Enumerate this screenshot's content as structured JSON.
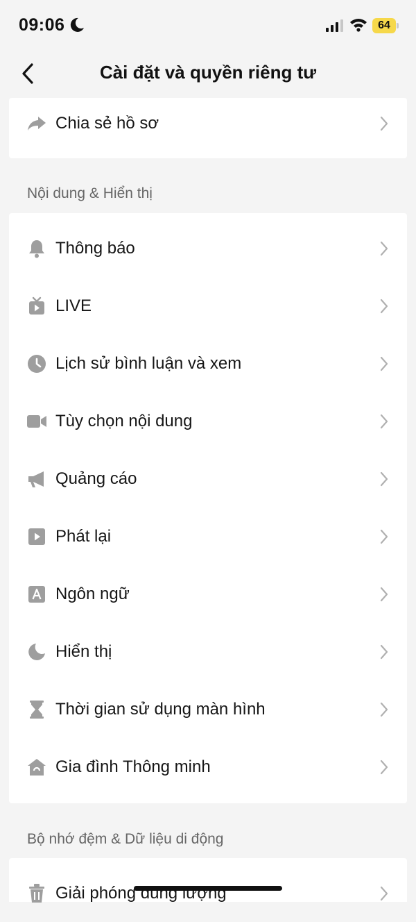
{
  "status_bar": {
    "time": "09:06",
    "battery_level": "64"
  },
  "nav": {
    "title": "Cài đặt và quyền riêng tư"
  },
  "top_items": [
    {
      "label": "Chia sẻ hồ sơ",
      "icon": "share-arrow-icon"
    }
  ],
  "sections": [
    {
      "header": "Nội dung & Hiển thị",
      "items": [
        {
          "label": "Thông báo",
          "icon": "bell-icon"
        },
        {
          "label": "LIVE",
          "icon": "live-tv-icon"
        },
        {
          "label": "Lịch sử bình luận và xem",
          "icon": "clock-icon"
        },
        {
          "label": "Tùy chọn nội dung",
          "icon": "video-camera-icon"
        },
        {
          "label": "Quảng cáo",
          "icon": "megaphone-icon"
        },
        {
          "label": "Phát lại",
          "icon": "play-square-icon"
        },
        {
          "label": "Ngôn ngữ",
          "icon": "language-a-icon"
        },
        {
          "label": "Hiển thị",
          "icon": "moon-icon"
        },
        {
          "label": "Thời gian sử dụng màn hình",
          "icon": "hourglass-icon"
        },
        {
          "label": "Gia đình Thông minh",
          "icon": "home-icon"
        }
      ]
    },
    {
      "header": "Bộ nhớ đệm & Dữ liệu di động",
      "items": [
        {
          "label": "Giải phóng dung lượng",
          "icon": "trash-icon"
        }
      ]
    }
  ],
  "colors": {
    "icon_gray": "#9e9e9e",
    "chevron_gray": "#b0b0b0",
    "battery_yellow": "#f6d84a"
  }
}
